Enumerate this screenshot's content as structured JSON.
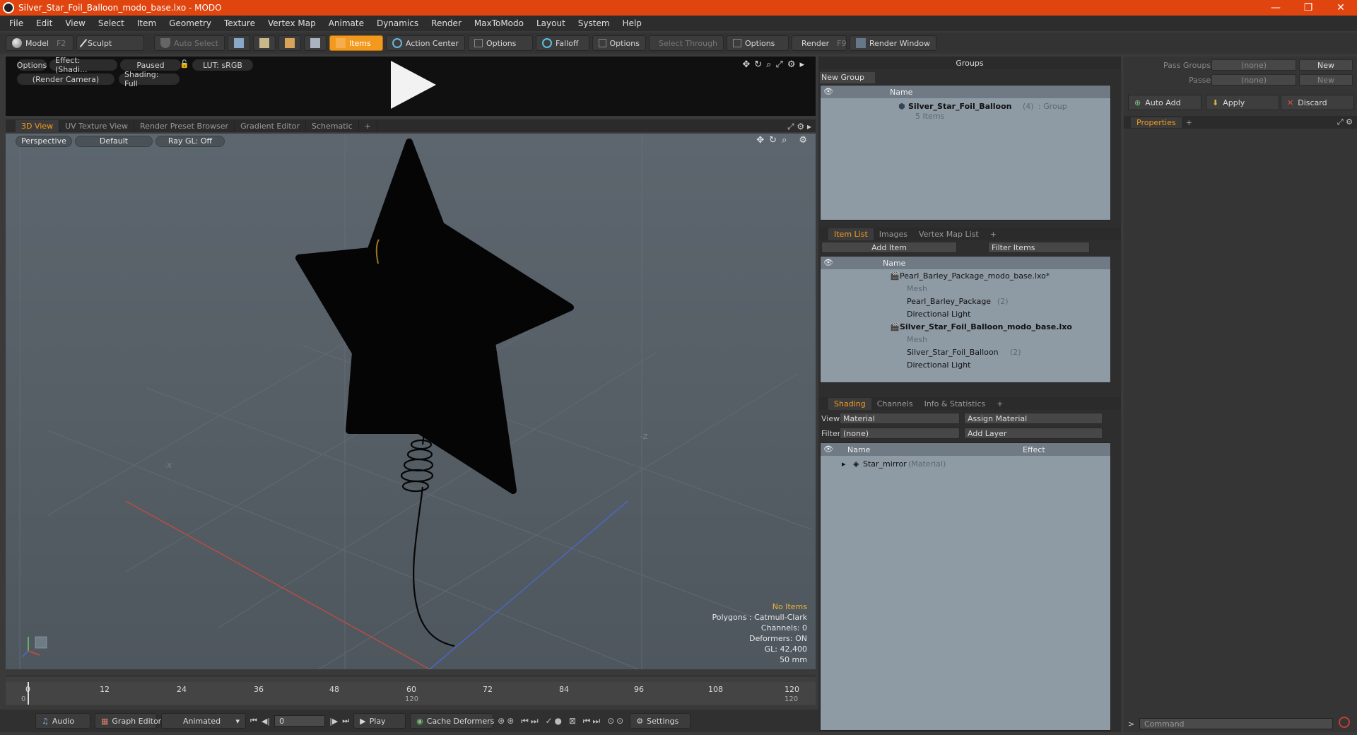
{
  "window": {
    "title": "Silver_Star_Foil_Balloon_modo_base.lxo - MODO",
    "minimize": "—",
    "maximize": "❐",
    "close": "✕"
  },
  "menu": [
    "File",
    "Edit",
    "View",
    "Select",
    "Item",
    "Geometry",
    "Texture",
    "Vertex Map",
    "Animate",
    "Dynamics",
    "Render",
    "MaxToModo",
    "Layout",
    "System",
    "Help"
  ],
  "toolbar": {
    "model": "Model",
    "model_key": "F2",
    "sculpt": "Sculpt",
    "auto_select": "Auto Select",
    "items": "Items",
    "action_center": "Action Center",
    "options1": "Options",
    "falloff": "Falloff",
    "options2": "Options",
    "select_through": "Select Through",
    "options3": "Options",
    "render": "Render",
    "render_key": "F9",
    "render_window": "Render Window"
  },
  "preview": {
    "options": "Options",
    "effect": "Effect: (Shadi...",
    "paused": "Paused",
    "lut": "LUT: sRGB",
    "camera": "(Render Camera)",
    "shading": "Shading: Full"
  },
  "viewport_tabs": [
    "3D View",
    "UV Texture View",
    "Render Preset Browser",
    "Gradient Editor",
    "Schematic",
    "+"
  ],
  "viewport": {
    "perspective": "Perspective",
    "default": "Default",
    "raygl": "Ray GL: Off",
    "axis_neg_x": "-X",
    "axis_neg_z": "-Z",
    "stats": {
      "no_items": "No Items",
      "polygons": "Polygons : Catmull-Clark",
      "channels": "Channels: 0",
      "deformers": "Deformers: ON",
      "gl": "GL: 42,400",
      "focal": "50 mm"
    }
  },
  "timeline": {
    "ticks": [
      "0",
      "12",
      "24",
      "36",
      "48",
      "60",
      "72",
      "84",
      "96",
      "108",
      "120"
    ],
    "start": "0",
    "mid": "120",
    "end": "120"
  },
  "bottombar": {
    "audio": "Audio",
    "graph_editor": "Graph Editor",
    "animated": "Animated",
    "frame": "0",
    "play": "Play",
    "cache_deformers": "Cache Deformers",
    "settings": "Settings"
  },
  "groups": {
    "title": "Groups",
    "new_group": "New Group",
    "col_name": "Name",
    "group_name": "Silver_Star_Foil_Balloon",
    "group_count": "(4)",
    "group_type": ": Group",
    "group_items": "5 Items"
  },
  "item_list": {
    "tabs": [
      "Item List",
      "Images",
      "Vertex Map List",
      "+"
    ],
    "add_item": "Add Item",
    "filter_items": "Filter Items",
    "col_name": "Name",
    "rows": [
      {
        "label": "Pearl_Barley_Package_modo_base.lxo*",
        "extra": ""
      },
      {
        "label": "Mesh",
        "extra": ""
      },
      {
        "label": "Pearl_Barley_Package",
        "extra": "(2)"
      },
      {
        "label": "Directional Light",
        "extra": ""
      },
      {
        "label": "Silver_Star_Foil_Balloon_modo_base.lxo",
        "extra": ""
      },
      {
        "label": "Mesh",
        "extra": ""
      },
      {
        "label": "Silver_Star_Foil_Balloon",
        "extra": "(2)"
      },
      {
        "label": "Directional Light",
        "extra": ""
      }
    ]
  },
  "shading": {
    "tabs": [
      "Shading",
      "Channels",
      "Info & Statistics",
      "+"
    ],
    "view_label": "View",
    "view_value": "Material",
    "assign_material": "Assign Material",
    "filter_label": "Filter",
    "filter_value": "(none)",
    "add_layer": "Add Layer",
    "col_name": "Name",
    "col_effect": "Effect",
    "row_name": "Star_mirror",
    "row_type": "(Material)"
  },
  "properties": {
    "pass_groups": "Pass Groups",
    "passes": "Passes",
    "none1": "(none)",
    "none2": "(none)",
    "new1": "New",
    "new2": "New",
    "auto_add": "Auto Add",
    "apply": "Apply",
    "discard": "Discard",
    "tab": "Properties",
    "tab_plus": "+",
    "command_placeholder": "Command"
  },
  "colors": {
    "title_bar": "#e0450f",
    "accent": "#f39a1e",
    "viewport": "#58616a",
    "list_bg": "#8e9aa4",
    "x_axis": "#d04a3a",
    "z_axis": "#4a6ad8"
  }
}
